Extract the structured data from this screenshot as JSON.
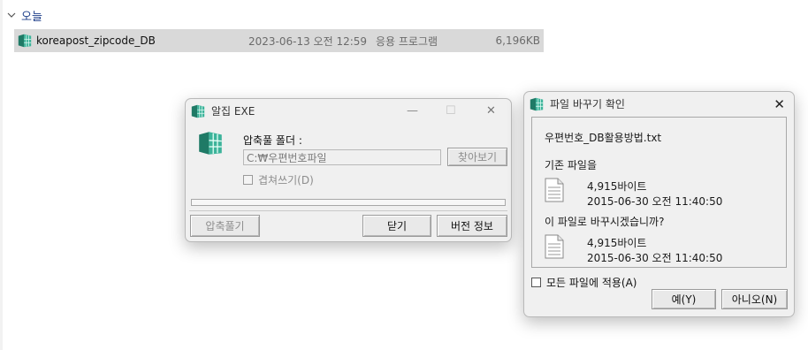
{
  "explorer": {
    "group_label": "오늘",
    "file": {
      "name": "koreapost_zipcode_DB",
      "date": "2023-06-13 오전 12:59",
      "type": "응용 프로그램",
      "size": "6,196KB"
    }
  },
  "alzip": {
    "title": "알집 EXE",
    "folder_label": "압축풀 폴더 :",
    "folder_value": "C:₩우편번호파일",
    "browse_label": "찾아보기",
    "overwrite_label": "겹쳐쓰기(D)",
    "extract_label": "압축풀기",
    "close_label": "닫기",
    "version_label": "버전 정보",
    "minimize_glyph": "—",
    "maximize_glyph": "☐",
    "close_glyph": "✕"
  },
  "replace_dialog": {
    "title": "파일 바꾸기 확인",
    "file_name": "우편번호_DB활용방법.txt",
    "existing_label": "기존 파일을",
    "existing_size": "4,915바이트",
    "existing_date": "2015-06-30 오전 11:40:50",
    "replace_label": "이 파일로 바꾸시겠습니까?",
    "new_size": "4,915바이트",
    "new_date": "2015-06-30 오전 11:40:50",
    "apply_all_label": "모든 파일에 적용(A)",
    "yes_label": "예(Y)",
    "no_label": "아니오(N)",
    "close_glyph": "✕"
  },
  "colors": {
    "accent_blue": "#1e3f8a",
    "icon_green": "#2f9e86",
    "selection_gray": "#d9d9d9"
  }
}
